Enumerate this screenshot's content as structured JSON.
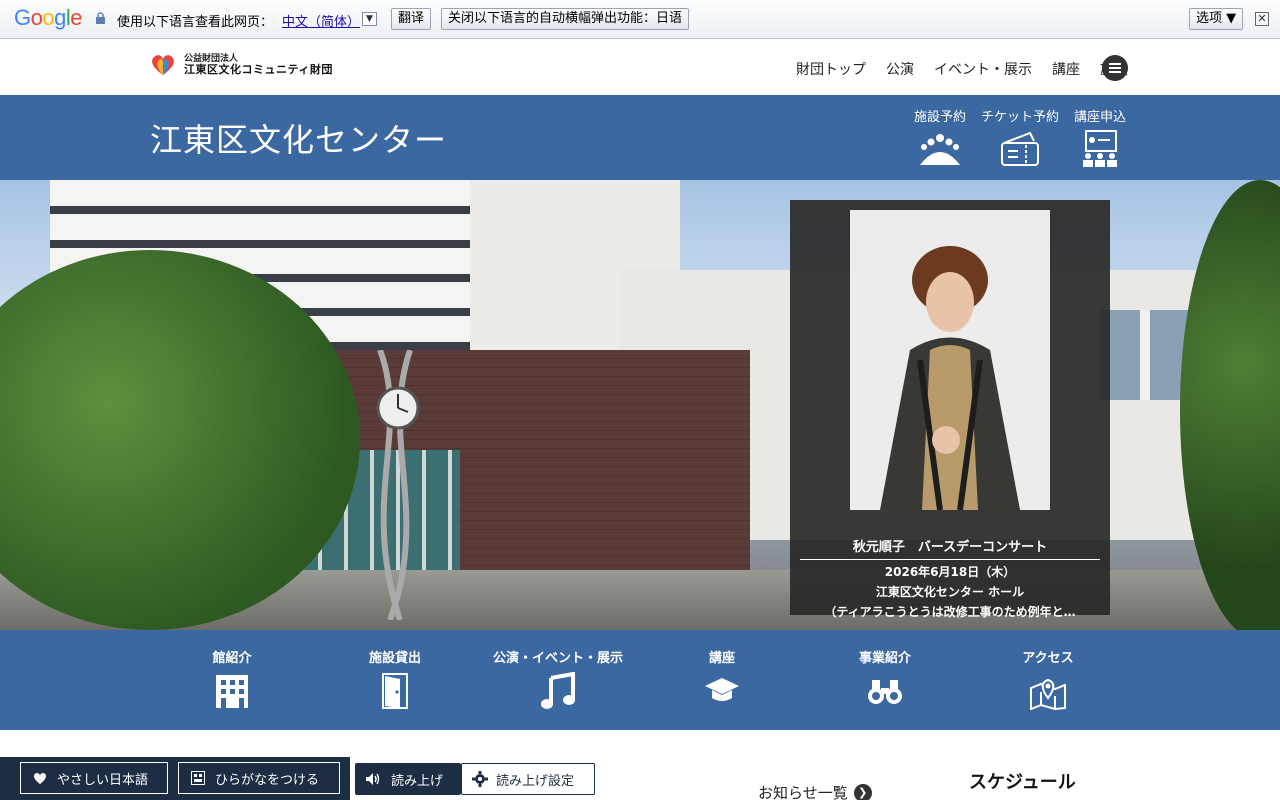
{
  "translate_bar": {
    "logo": "Google",
    "prompt": "使用以下语言查看此网页：",
    "language": "中文（简体）",
    "translate_button": "翻译",
    "disable_button": "关闭以下语言的自动横幅弹出功能：日语",
    "options_button": "选项 ▼",
    "close": "✕"
  },
  "header": {
    "logo_sub": "公益財団法人",
    "logo_main": "江東区文化コミュニティ財団",
    "nav": [
      "財団トップ",
      "公演",
      "イベント・展示",
      "講座",
      "施設"
    ]
  },
  "title_bar": {
    "title": "江東区文化センター",
    "quick_links": [
      {
        "label": "施設予約",
        "icon": "audience-icon"
      },
      {
        "label": "チケット予約",
        "icon": "ticket-icon"
      },
      {
        "label": "講座申込",
        "icon": "lecture-icon"
      }
    ]
  },
  "event": {
    "title": "秋元順子　バースデーコンサート",
    "date": "2026年6月18日（木）",
    "venue": "江東区文化センター ホール",
    "note": "（ティアラこうとうは改修工事のため例年と…"
  },
  "main_nav": [
    {
      "label": "館紹介",
      "icon": "building-icon"
    },
    {
      "label": "施設貸出",
      "icon": "door-icon"
    },
    {
      "label": "公演・イベント・展示",
      "icon": "music-note-icon"
    },
    {
      "label": "講座",
      "icon": "graduation-cap-icon"
    },
    {
      "label": "事業紹介",
      "icon": "binoculars-icon"
    },
    {
      "label": "アクセス",
      "icon": "map-icon"
    }
  ],
  "accessibility": {
    "easy_japanese": "やさしい日本語",
    "furigana": "ひらがなをつける",
    "read_aloud": "読み上げ",
    "read_settings": "読み上げ設定"
  },
  "news": {
    "link": "お知らせ一覧"
  },
  "schedule": {
    "heading": "スケジュール"
  },
  "colors": {
    "brand_blue": "#3c68a2",
    "dark_navy": "#1c2d44"
  }
}
